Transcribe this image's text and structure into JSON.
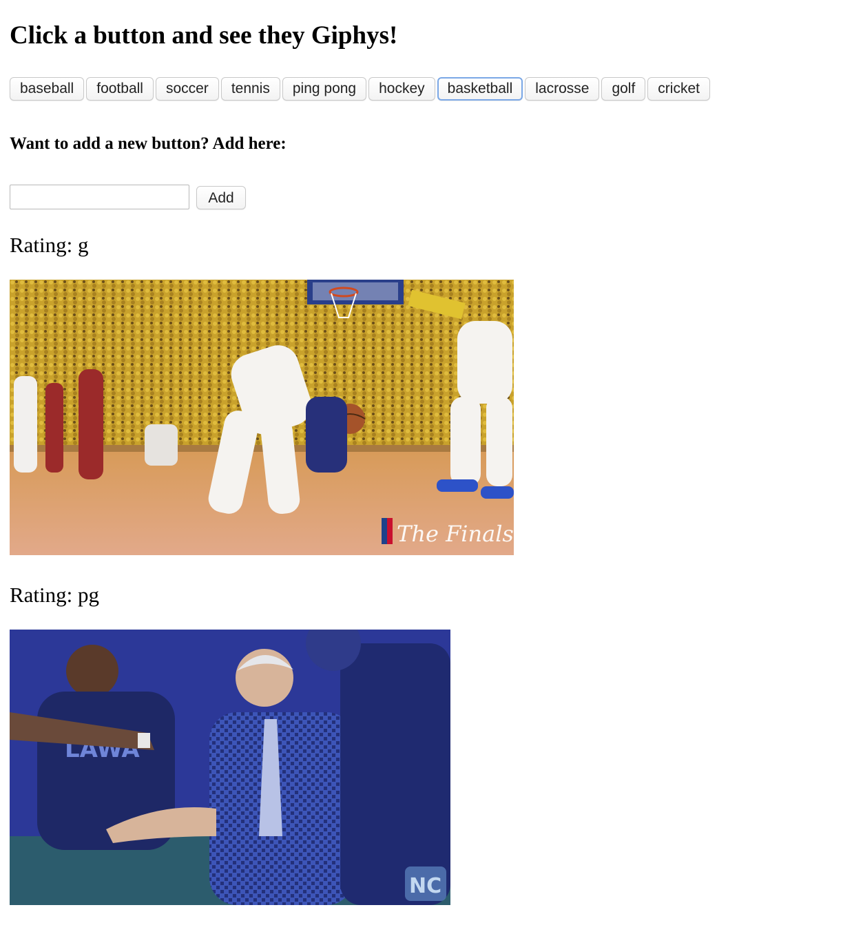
{
  "page": {
    "title": "Click a button and see they Giphys!"
  },
  "topics": [
    {
      "label": "baseball"
    },
    {
      "label": "football"
    },
    {
      "label": "soccer"
    },
    {
      "label": "tennis"
    },
    {
      "label": "ping pong"
    },
    {
      "label": "hockey"
    },
    {
      "label": "basketball",
      "focused": true
    },
    {
      "label": "lacrosse"
    },
    {
      "label": "golf"
    },
    {
      "label": "cricket"
    }
  ],
  "add_form": {
    "heading": "Want to add a new button? Add here:",
    "input_value": "",
    "button_label": "Add"
  },
  "results": [
    {
      "rating_text": "Rating: g",
      "watermark_text": "The Finals",
      "scene": "basketball-finals"
    },
    {
      "rating_text": "Rating: pg",
      "watermark_text": "NC",
      "scene": "basketball-coach-celebration"
    }
  ],
  "colors": {
    "focus_ring": "#7aa7e6",
    "crowd": "#c9a22c",
    "court": "#c98a4a",
    "jersey_blue": "#27307a",
    "uniform_white": "#f5f3f0"
  }
}
